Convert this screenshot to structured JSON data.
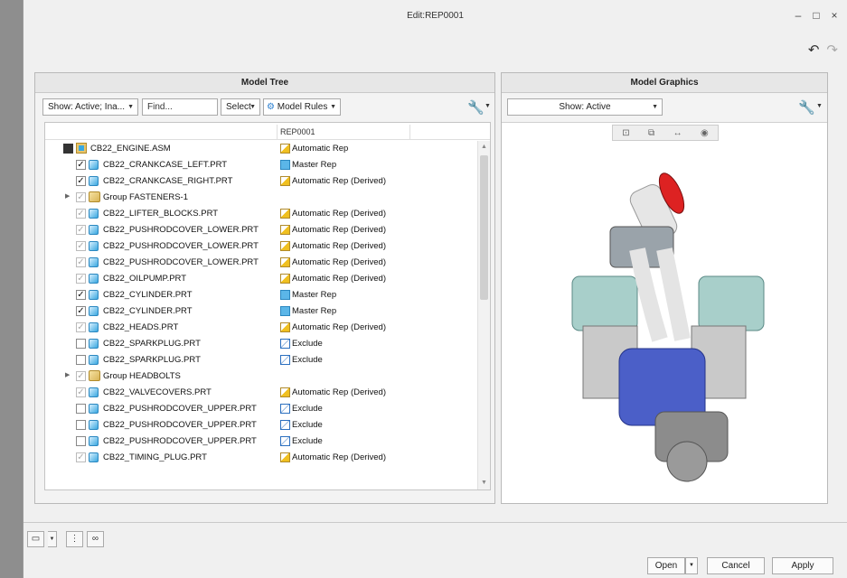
{
  "window": {
    "title": "Edit:REP0001",
    "controls": [
      "–",
      "□",
      "×"
    ]
  },
  "toolbar_top": {
    "undo_icon": "undo-icon",
    "redo_icon": "redo-icon"
  },
  "model_tree": {
    "header": "Model Tree",
    "show_select": "Show: Active; Ina...",
    "find_placeholder": "Find...",
    "select_label": "Select",
    "model_rules_label": "Model Rules",
    "column_header": "REP0001",
    "rows": [
      {
        "indent": 0,
        "exp": "",
        "cb": "dark",
        "icon": "asm",
        "name": "CB22_ENGINE.ASM",
        "rep": "Automatic Rep",
        "rep_type": "auto"
      },
      {
        "indent": 1,
        "exp": "",
        "cb": "checked",
        "icon": "part",
        "name": "CB22_CRANKCASE_LEFT.PRT",
        "rep": "Master Rep",
        "rep_type": "master"
      },
      {
        "indent": 1,
        "exp": "",
        "cb": "checked",
        "icon": "part",
        "name": "CB22_CRANKCASE_RIGHT.PRT",
        "rep": "Automatic Rep (Derived)",
        "rep_type": "auto"
      },
      {
        "indent": 1,
        "exp": "▶",
        "cb": "dim",
        "icon": "grp",
        "name": "Group FASTENERS-1",
        "rep": "",
        "rep_type": ""
      },
      {
        "indent": 1,
        "exp": "",
        "cb": "dim",
        "icon": "part",
        "name": "CB22_LIFTER_BLOCKS.PRT",
        "rep": "Automatic Rep (Derived)",
        "rep_type": "auto"
      },
      {
        "indent": 1,
        "exp": "",
        "cb": "dim",
        "icon": "part",
        "name": "CB22_PUSHRODCOVER_LOWER.PRT",
        "rep": "Automatic Rep (Derived)",
        "rep_type": "auto"
      },
      {
        "indent": 1,
        "exp": "",
        "cb": "dim",
        "icon": "part",
        "name": "CB22_PUSHRODCOVER_LOWER.PRT",
        "rep": "Automatic Rep (Derived)",
        "rep_type": "auto"
      },
      {
        "indent": 1,
        "exp": "",
        "cb": "dim",
        "icon": "part",
        "name": "CB22_PUSHRODCOVER_LOWER.PRT",
        "rep": "Automatic Rep (Derived)",
        "rep_type": "auto"
      },
      {
        "indent": 1,
        "exp": "",
        "cb": "dim",
        "icon": "part",
        "name": "CB22_OILPUMP.PRT",
        "rep": "Automatic Rep (Derived)",
        "rep_type": "auto"
      },
      {
        "indent": 1,
        "exp": "",
        "cb": "checked",
        "icon": "part",
        "name": "CB22_CYLINDER.PRT",
        "rep": "Master Rep",
        "rep_type": "master"
      },
      {
        "indent": 1,
        "exp": "",
        "cb": "checked",
        "icon": "part",
        "name": "CB22_CYLINDER.PRT",
        "rep": "Master Rep",
        "rep_type": "master"
      },
      {
        "indent": 1,
        "exp": "",
        "cb": "dim",
        "icon": "part",
        "name": "CB22_HEADS.PRT",
        "rep": "Automatic Rep (Derived)",
        "rep_type": "auto"
      },
      {
        "indent": 1,
        "exp": "",
        "cb": "empty",
        "icon": "part",
        "name": "CB22_SPARKPLUG.PRT",
        "rep": "Exclude",
        "rep_type": "exclude"
      },
      {
        "indent": 1,
        "exp": "",
        "cb": "empty",
        "icon": "part",
        "name": "CB22_SPARKPLUG.PRT",
        "rep": "Exclude",
        "rep_type": "exclude"
      },
      {
        "indent": 1,
        "exp": "▶",
        "cb": "dim",
        "icon": "grp",
        "name": "Group HEADBOLTS",
        "rep": "",
        "rep_type": ""
      },
      {
        "indent": 1,
        "exp": "",
        "cb": "dim",
        "icon": "part",
        "name": "CB22_VALVECOVERS.PRT",
        "rep": "Automatic Rep (Derived)",
        "rep_type": "auto"
      },
      {
        "indent": 1,
        "exp": "",
        "cb": "empty",
        "icon": "part",
        "name": "CB22_PUSHRODCOVER_UPPER.PRT",
        "rep": "Exclude",
        "rep_type": "exclude"
      },
      {
        "indent": 1,
        "exp": "",
        "cb": "empty",
        "icon": "part",
        "name": "CB22_PUSHRODCOVER_UPPER.PRT",
        "rep": "Exclude",
        "rep_type": "exclude"
      },
      {
        "indent": 1,
        "exp": "",
        "cb": "empty",
        "icon": "part",
        "name": "CB22_PUSHRODCOVER_UPPER.PRT",
        "rep": "Exclude",
        "rep_type": "exclude"
      },
      {
        "indent": 1,
        "exp": "",
        "cb": "dim",
        "icon": "part",
        "name": "CB22_TIMING_PLUG.PRT",
        "rep": "Automatic Rep (Derived)",
        "rep_type": "auto"
      }
    ]
  },
  "model_graphics": {
    "header": "Model Graphics",
    "show_select": "Show: Active"
  },
  "buttons": {
    "open": "Open",
    "cancel": "Cancel",
    "apply": "Apply"
  }
}
